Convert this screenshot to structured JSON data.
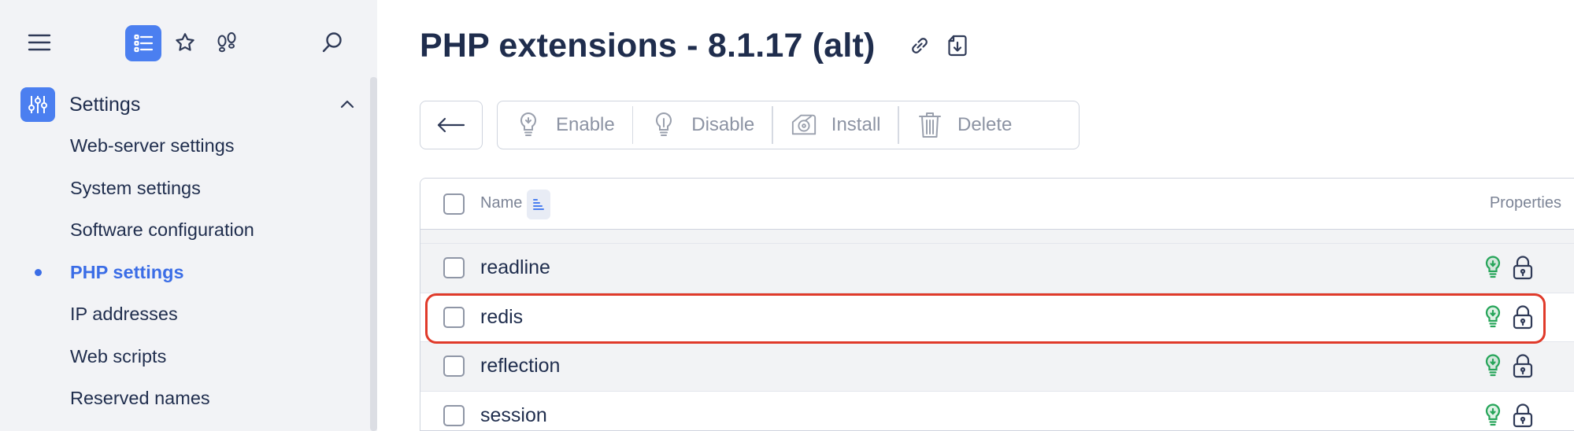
{
  "sidebar": {
    "section_label": "Settings",
    "items": [
      {
        "label": "Web-server settings",
        "active": false
      },
      {
        "label": "System settings",
        "active": false
      },
      {
        "label": "Software configuration",
        "active": false
      },
      {
        "label": "PHP settings",
        "active": true
      },
      {
        "label": "IP addresses",
        "active": false
      },
      {
        "label": "Web scripts",
        "active": false
      },
      {
        "label": "Reserved names",
        "active": false
      }
    ]
  },
  "header": {
    "title": "PHP extensions - 8.1.17 (alt)"
  },
  "toolbar": {
    "enable_label": "Enable",
    "disable_label": "Disable",
    "install_label": "Install",
    "delete_label": "Delete"
  },
  "table": {
    "columns": {
      "name": "Name",
      "properties": "Properties"
    },
    "rows": [
      {
        "name": "readline",
        "properties": [
          "bulb-icon",
          "lock-icon"
        ]
      },
      {
        "name": "redis",
        "properties": [
          "bulb-icon",
          "lock-icon"
        ],
        "highlighted": true
      },
      {
        "name": "reflection",
        "properties": [
          "bulb-icon",
          "lock-icon"
        ]
      },
      {
        "name": "session",
        "properties": [
          "bulb-icon",
          "lock-icon"
        ]
      }
    ]
  },
  "colors": {
    "accent": "#4b7ff0",
    "active_text": "#3b6de6",
    "enabled_bulb": "#27a55a",
    "highlight": "#e03a2a",
    "text": "#1f2d4d"
  }
}
